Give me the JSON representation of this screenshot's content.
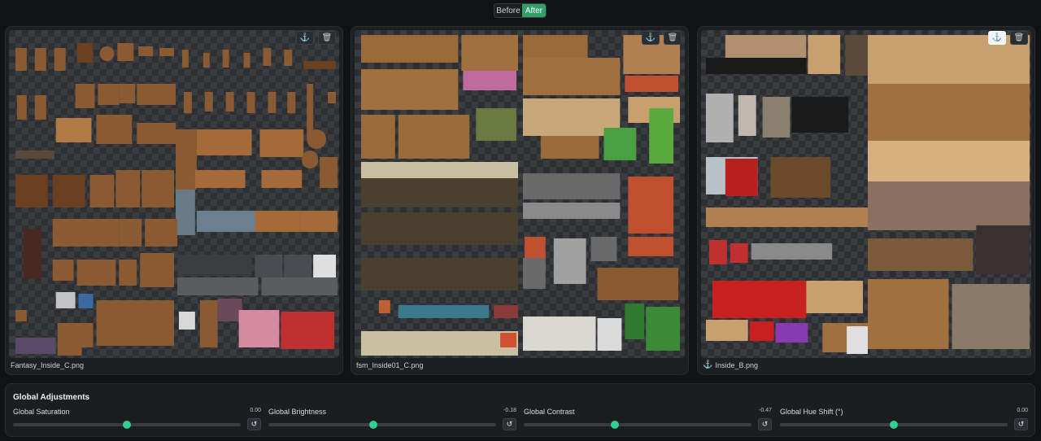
{
  "toggle": {
    "before_label": "Before",
    "after_label": "After"
  },
  "panels": [
    {
      "filename": "Fantasy_Inside_C.png",
      "anchor_active": false
    },
    {
      "filename": "fsm_Inside01_C.png",
      "anchor_active": false
    },
    {
      "filename": "Inside_B.png",
      "anchor_active": true
    }
  ],
  "icons": {
    "anchor": "⚓",
    "trash": "🗑",
    "reset": "↺"
  },
  "adjustments": {
    "title": "Global Adjustments",
    "controls": [
      {
        "label": "Global Saturation",
        "value": "0.00",
        "fraction": 0.5
      },
      {
        "label": "Global Brightness",
        "value": "-0.18",
        "fraction": 0.46
      },
      {
        "label": "Global Contrast",
        "value": "-0.47",
        "fraction": 0.4
      },
      {
        "label": "Global Hue Shift (°)",
        "value": "0.00",
        "fraction": 0.5
      }
    ]
  },
  "colors": {
    "accent": "#2fd192",
    "after_bg": "#2fa06a",
    "anchor_blue": "#2d7be0"
  }
}
